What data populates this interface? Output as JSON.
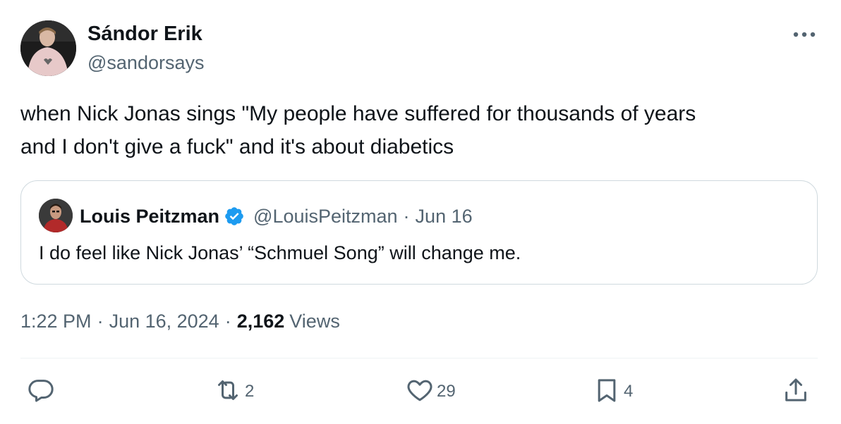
{
  "author": {
    "name": "Sándor Erik",
    "handle": "@sandorsays"
  },
  "tweet": {
    "text_line1": "when Nick Jonas sings \"My people have suffered for thousands of years",
    "text_line2": "and I don't give a fuck\" and it's about diabetics"
  },
  "quote": {
    "name": "Louis Peitzman",
    "handle": "@LouisPeitzman",
    "separator": "·",
    "date": "Jun 16",
    "verified": true,
    "text": "I do feel like Nick Jonas’ “Schmuel Song” will change me."
  },
  "meta": {
    "time": "1:22 PM",
    "separator": "·",
    "date": "Jun 16, 2024",
    "views_count": "2,162",
    "views_label": "Views"
  },
  "actions": {
    "reply_count": "",
    "retweet_count": "2",
    "like_count": "29",
    "bookmark_count": "4"
  },
  "colors": {
    "primary_text": "#0f1419",
    "secondary_text": "#536471",
    "border": "#cfd9de",
    "verified_blue": "#1d9bf0"
  },
  "icons": [
    "more-icon",
    "verified-badge-icon",
    "reply-icon",
    "retweet-icon",
    "like-icon",
    "bookmark-icon",
    "share-icon"
  ]
}
